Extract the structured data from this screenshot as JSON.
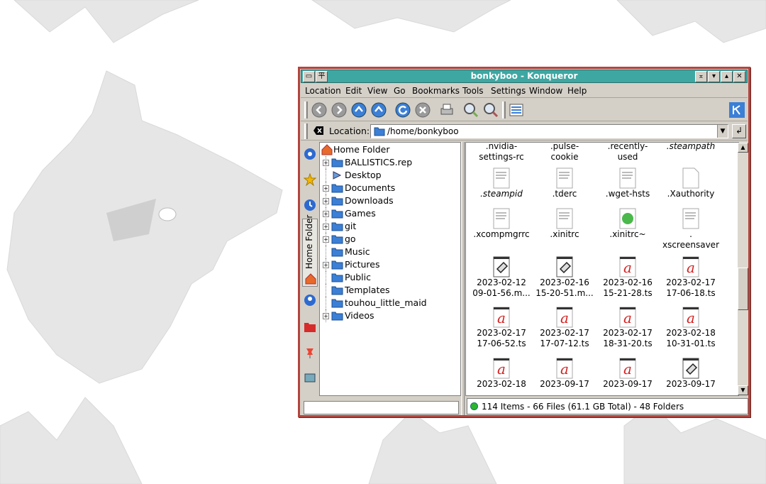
{
  "window": {
    "title": "bonkyboo - Konqueror"
  },
  "menu": [
    "Location",
    "Edit",
    "View",
    "Go",
    "Bookmarks",
    "Tools",
    "Settings",
    "Window",
    "Help"
  ],
  "location": {
    "label": "Location:",
    "value": "/home/bonkyboo"
  },
  "sidebar": {
    "tab_label": "Home Folder"
  },
  "tree": {
    "root": "Home Folder",
    "items": [
      "BALLISTICS.rep",
      "Desktop",
      "Documents",
      "Downloads",
      "Games",
      "git",
      "go",
      "Music",
      "Pictures",
      "Public",
      "Templates",
      "touhou_little_maid",
      "Videos"
    ]
  },
  "files": {
    "row0": [
      ".nvidia-\nsettings-rc",
      ".pulse-\ncookie",
      ".recently-\nused",
      ".steampath"
    ],
    "row1": [
      ".steampid",
      ".tderc",
      ".wget-hsts",
      ".Xauthority"
    ],
    "row2": [
      ".xcompmgrrc",
      ".xinitrc",
      ".xinitrc~",
      ".\nxscreensaver"
    ],
    "row3": [
      "2023-02-12\n09-01-56.m...",
      "2023-02-16\n15-20-51.m...",
      "2023-02-16\n15-21-28.ts",
      "2023-02-17\n17-06-18.ts"
    ],
    "row4": [
      "2023-02-17\n17-06-52.ts",
      "2023-02-17\n17-07-12.ts",
      "2023-02-17\n18-31-20.ts",
      "2023-02-18\n10-31-01.ts"
    ],
    "row5": [
      "2023-02-18",
      "2023-09-17",
      "2023-09-17",
      "2023-09-17"
    ]
  },
  "status": {
    "text": "114 Items - 66 Files (61.1 GB Total) - 48 Folders"
  },
  "colors": {
    "titlebar": "#3ea7a2",
    "frame": "#b2453e",
    "folder": "#3b7fd6"
  }
}
